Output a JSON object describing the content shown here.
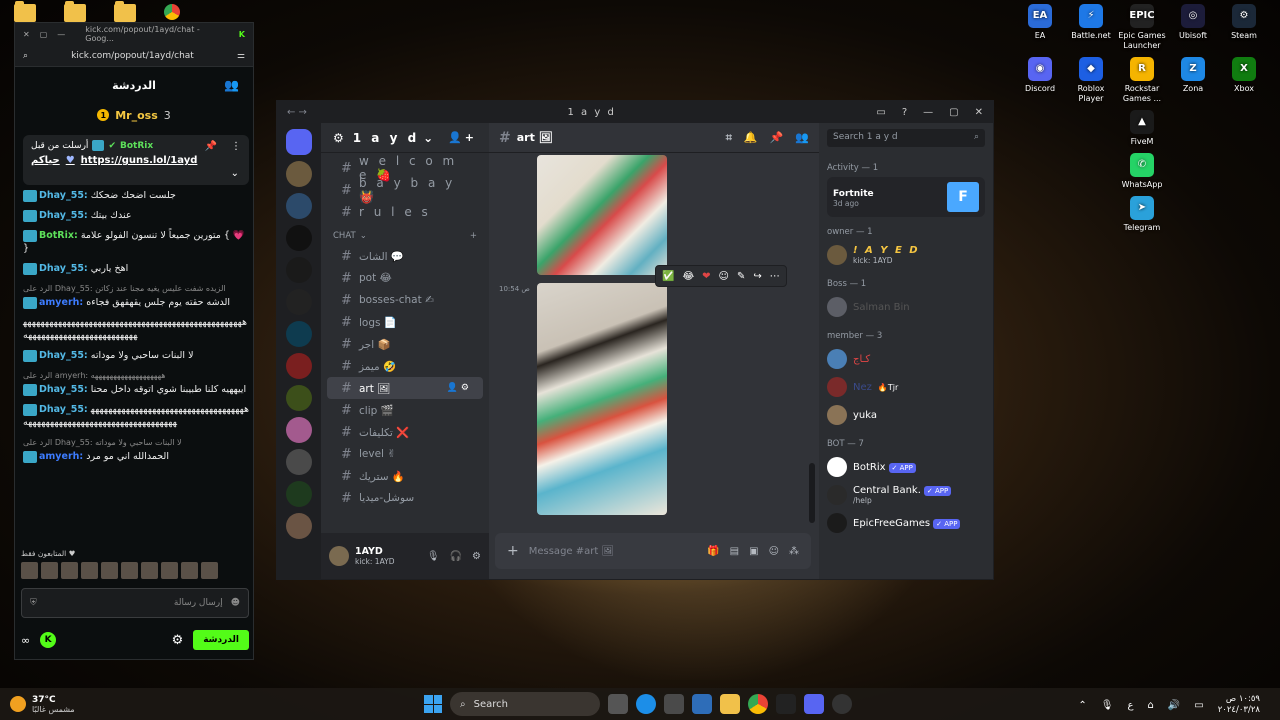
{
  "desktop": {
    "icons": [
      {
        "label": "EA",
        "color": "#2b6bd8",
        "glyph": "EA"
      },
      {
        "label": "Battle.net",
        "color": "#1e78e6",
        "glyph": "⚡"
      },
      {
        "label": "Epic Games Launcher",
        "color": "#222222",
        "glyph": "EPIC"
      },
      {
        "label": "Ubisoft",
        "color": "#1c1c3a",
        "glyph": "◎"
      },
      {
        "label": "Steam",
        "color": "#1b2838",
        "glyph": "⚙"
      },
      {
        "label": "Discord",
        "color": "#5865f2",
        "glyph": "◉"
      },
      {
        "label": "Roblox Player",
        "color": "#1d5fe3",
        "glyph": "◆"
      },
      {
        "label": "Rockstar Games ...",
        "color": "#f5b400",
        "glyph": "R"
      },
      {
        "label": "Zona",
        "color": "#1e88e5",
        "glyph": "Z"
      },
      {
        "label": "Xbox",
        "color": "#107c10",
        "glyph": "X"
      },
      {
        "label": "FiveM",
        "color": "#1a1a1a",
        "glyph": "▲"
      },
      {
        "label": "WhatsApp",
        "color": "#25d366",
        "glyph": "✆"
      },
      {
        "label": "Telegram",
        "color": "#2aa1da",
        "glyph": "➤"
      }
    ]
  },
  "kick": {
    "tab_title": "kick.com/popout/1ayd/chat - Goog...",
    "url": "kick.com/popout/1ayd/chat",
    "header": "الدردشة",
    "top_gifter": "Mr_oss",
    "top_gifter_count": "3",
    "pinned": {
      "label": "أرسلت من قبل",
      "user": "BotRix",
      "prefix": "حياكم",
      "link": "https://guns.lol/1ayd"
    },
    "messages": [
      {
        "user": "Dhay_55:",
        "text": "جلست اضحك ضحكك",
        "reply": ""
      },
      {
        "user": "Dhay_55:",
        "text": "عندك بيتك",
        "reply": ""
      },
      {
        "user": "BotRix:",
        "text": "متورين جميعاً لا تنسون الفولو علامة { 💗 }",
        "reply": ""
      },
      {
        "user": "Dhay_55:",
        "text": "اهخ ياربي",
        "reply": ""
      },
      {
        "user": "amyerh:",
        "text": "الدشه حقته يوم جلس يقهقهق فجاءه",
        "reply": "الرد على Dhay_55: الزيده شفت عليس يغيه مجنا عند زكاتن"
      },
      {
        "user": "",
        "text": "ههههههههههههههههههههههههههههههههههههههههههههههههههههههههههههههههههههههههههههه",
        "reply": ""
      },
      {
        "user": "Dhay_55:",
        "text": "لا البنات ساحبي ولا موداته",
        "reply": ""
      },
      {
        "user": "Dhay_55:",
        "text": "اييههيه كلنا طبيبنا شوي اتوقه داخل محنا",
        "reply": "الرد على amyerh: هههههههههههههههههههه"
      },
      {
        "user": "Dhay_55:",
        "text": "ههههههههههههههههههههههههههههههههههههههههههههههههههههههههههههههههههههههه",
        "reply": ""
      },
      {
        "user": "amyerh:",
        "text": "الحمدالله اني مو مرد",
        "reply": "الرد على Dhay_55: لا البنات ساحبي ولا موداته"
      }
    ],
    "viewers_label": "المتابعون فقط ♥",
    "input_placeholder": "إرسال رسالة",
    "send_label": "الدردشة"
  },
  "discord": {
    "window_title": "1 a y d",
    "server_name": "1 a y d",
    "channels_top": [
      {
        "name": "w e l c o m e 🍓"
      },
      {
        "name": "b a y b a y 👹"
      },
      {
        "name": "r u l e s"
      }
    ],
    "category": "CHAT",
    "channels": [
      {
        "name": "الشات 💬"
      },
      {
        "name": "pot 😂"
      },
      {
        "name": "bosses-chat ✍"
      },
      {
        "name": "logs 📄"
      },
      {
        "name": "اجر 📦"
      },
      {
        "name": "ميمز 🤣"
      },
      {
        "name": "art 🖼"
      },
      {
        "name": "clip 🎬"
      },
      {
        "name": "تكليفات ❌"
      },
      {
        "name": "level ✌"
      },
      {
        "name": "ستريك 🔥"
      },
      {
        "name": "سوشل-ميديا"
      }
    ],
    "active_channel": "art 🖼",
    "user": {
      "name": "1AYD",
      "status": "kick: 1AYD"
    },
    "timestamp": "10:54 ص",
    "composer_placeholder": "Message #art 🖼",
    "search_placeholder": "Search 1 a y d",
    "members": {
      "activity_header": "Activity — 1",
      "activity_game": "Fortnite",
      "activity_time": "3d ago",
      "owner_header": "owner — 1",
      "owner_name": "! A Y E D",
      "owner_status": "kick: 1AYD",
      "boss_header": "Boss — 1",
      "boss_name": "Salman Bin",
      "member_header": "member — 3",
      "members": [
        {
          "name": "كـاج",
          "tag": ""
        },
        {
          "name": "Nez",
          "tag": "🔥Tjr"
        },
        {
          "name": "yuka",
          "tag": ""
        }
      ],
      "bot_header": "BOT — 7",
      "bots": [
        {
          "name": "BotRix",
          "tag": "✓ APP",
          "sub": ""
        },
        {
          "name": "Central Bank.",
          "tag": "✓ APP",
          "sub": "/help"
        },
        {
          "name": "EpicFreeGames",
          "tag": "✓ APP",
          "sub": ""
        }
      ]
    }
  },
  "taskbar": {
    "temp": "37°C",
    "weather": "مشمس غالبًا",
    "search": "Search",
    "lang": "ع",
    "time": "١٠:٥٩ ص",
    "date": "٢٠٢٤/٠٣/٢٨"
  }
}
